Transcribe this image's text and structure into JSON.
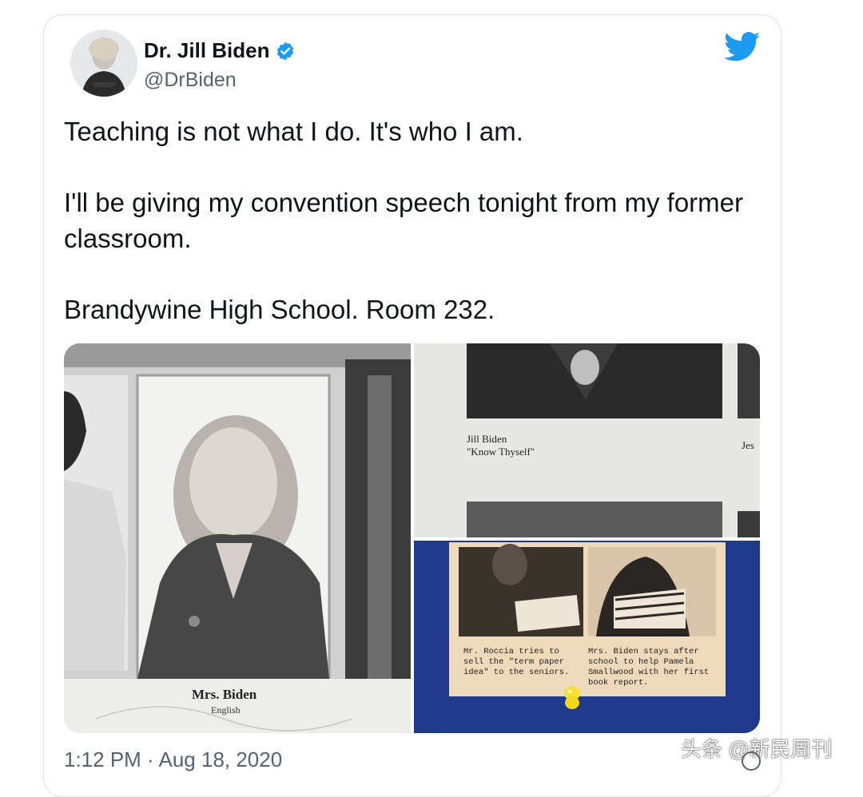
{
  "tweet": {
    "author_name": "Dr. Jill Biden",
    "author_handle": "@DrBiden",
    "paragraphs": [
      "Teaching is not what I do. It's who I am.",
      "I'll be giving my convention speech tonight from my former classroom.",
      "Brandywine High School. Room 232."
    ],
    "timestamp": "1:12 PM · Aug 18, 2020",
    "verified_icon": "verified-badge-icon",
    "platform_icon": "twitter-bird-icon"
  },
  "media": {
    "left_photo": {
      "caption_name": "Mrs. Biden",
      "caption_subject": "English"
    },
    "top_right_photo": {
      "name": "Jill Biden",
      "quote": "\"Know Thyself\"",
      "partial_text": "Jes"
    },
    "bottom_right_photo": {
      "caption_left": "Mr. Roccia tries to sell the \"term paper idea\" to the seniors.",
      "caption_right": "Mrs. Biden stays after school to help Pamela Smallwood with her first book report."
    }
  },
  "watermark": "头条 @新民周刊",
  "colors": {
    "twitter_blue": "#1d9bf0",
    "text_primary": "#0f1419",
    "text_secondary": "#536471",
    "board_blue": "#1f3a8a",
    "clipping_paper": "#efd9bb"
  }
}
